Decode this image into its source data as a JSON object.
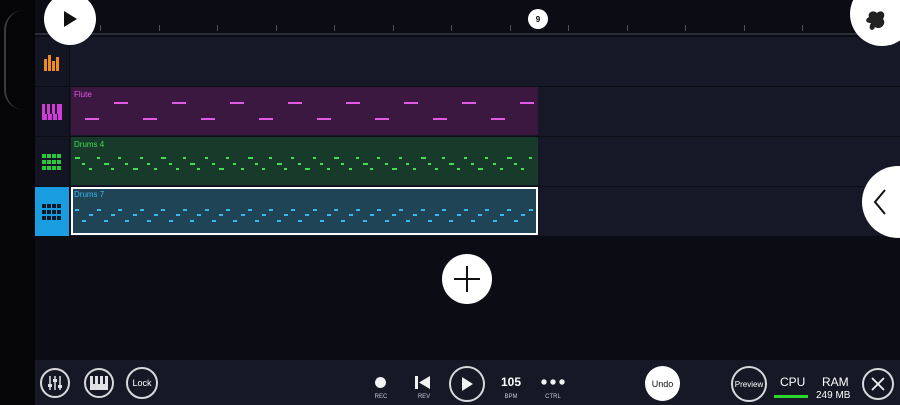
{
  "transport": {
    "rec_label": "REC",
    "rev_label": "REV",
    "bpm_value": "105",
    "bpm_label": "BPM",
    "ctrl_label": "CTRL",
    "undo_label": "Undo",
    "preview_label": "Preview",
    "lock_label": "Lock"
  },
  "timeline": {
    "playhead_bar": "9"
  },
  "system": {
    "cpu_label": "CPU",
    "ram_label": "RAM",
    "ram_value": "249 MB",
    "cpu_level": 1.0
  },
  "tracks": [
    {
      "name": "",
      "icon": "mixer-bars-icon",
      "color": "#f08a1e"
    },
    {
      "name": "Flute",
      "icon": "piano-keys-icon",
      "color": "#d23ad7"
    },
    {
      "name": "Drums 4",
      "icon": "drum-pads-icon",
      "color": "#28c93a"
    },
    {
      "name": "Drums 7",
      "icon": "drum-pads-icon",
      "color": "#2ab0e8"
    }
  ],
  "colors": {
    "flute_clip_bg": "#3a1840",
    "drums4_clip_bg": "#173a2a",
    "drums7_clip_bg": "#1f4455",
    "selected_track": "#1a9de0"
  }
}
